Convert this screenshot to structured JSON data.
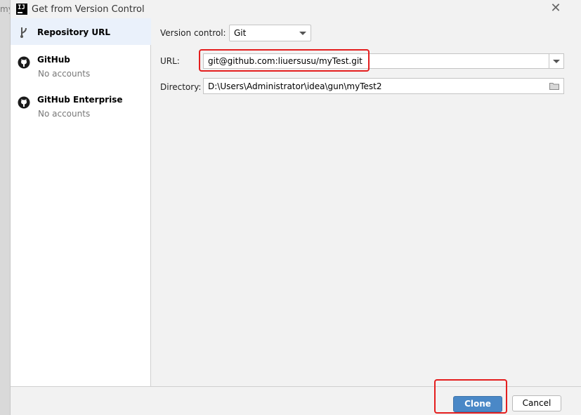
{
  "background": {
    "text": "my"
  },
  "window": {
    "title": "Get from Version Control",
    "close_glyph": "✕"
  },
  "sidebar": {
    "items": [
      {
        "label": "Repository URL",
        "icon": "vcs-branch-icon",
        "selected": true
      },
      {
        "label": "GitHub",
        "sublabel": "No accounts",
        "icon": "github-icon"
      },
      {
        "label": "GitHub Enterprise",
        "sublabel": "No accounts",
        "icon": "github-icon"
      }
    ]
  },
  "form": {
    "version_control_label": "Version control:",
    "version_control_value": "Git",
    "url_label": "URL:",
    "url_value": "git@github.com:liuersusu/myTest.git",
    "directory_label": "Directory:",
    "directory_value": "D:\\Users\\Administrator\\idea\\gun\\myTest2"
  },
  "buttons": {
    "clone": "Clone",
    "cancel": "Cancel"
  },
  "colors": {
    "primary": "#4a88c7",
    "highlight": "#e41e1e",
    "selected_bg": "#eaf1fb"
  }
}
